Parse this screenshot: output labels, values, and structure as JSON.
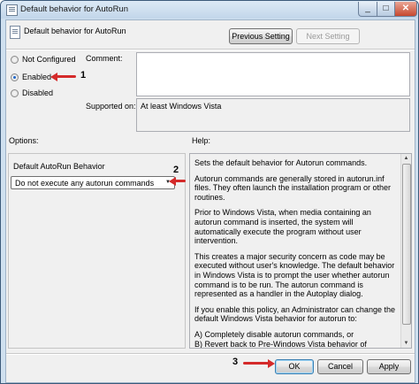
{
  "window": {
    "title": "Default behavior for AutoRun"
  },
  "header": {
    "title": "Default behavior for AutoRun",
    "previous_label": "Previous Setting",
    "next_label": "Next Setting"
  },
  "state": {
    "options": [
      {
        "label": "Not Configured",
        "checked": false
      },
      {
        "label": "Enabled",
        "checked": true
      },
      {
        "label": "Disabled",
        "checked": false
      }
    ]
  },
  "comment": {
    "label": "Comment:",
    "value": ""
  },
  "supported": {
    "label": "Supported on:",
    "value": "At least Windows Vista"
  },
  "options_pane": {
    "label": "Options:",
    "field_label": "Default AutoRun Behavior",
    "selected": "Do not execute any autorun commands"
  },
  "help_pane": {
    "label": "Help:",
    "paragraphs": [
      "Sets the default behavior for Autorun commands.",
      "Autorun commands are generally stored in autorun.inf files. They often launch the installation program or other routines.",
      "Prior to Windows Vista, when media containing an autorun command is inserted, the system will automatically execute the program without user intervention.",
      "This creates a major security concern as code may be executed without user's knowledge. The default behavior in Windows Vista is to prompt the user whether autorun command is to be run. The autorun command is represented as a handler in the Autoplay dialog.",
      "If you enable this policy, an Administrator can change the default Windows Vista behavior for autorun to:",
      "A) Completely disable autorun commands, or\nB) Revert back to Pre-Windows Vista behavior of automatically executing the autorun command."
    ]
  },
  "footer": {
    "ok_label": "OK",
    "cancel_label": "Cancel",
    "apply_label": "Apply"
  },
  "callouts": {
    "one": "1",
    "two": "2",
    "three": "3"
  },
  "colors": {
    "arrow": "#d42a2a",
    "selection": "#1e66c8"
  }
}
